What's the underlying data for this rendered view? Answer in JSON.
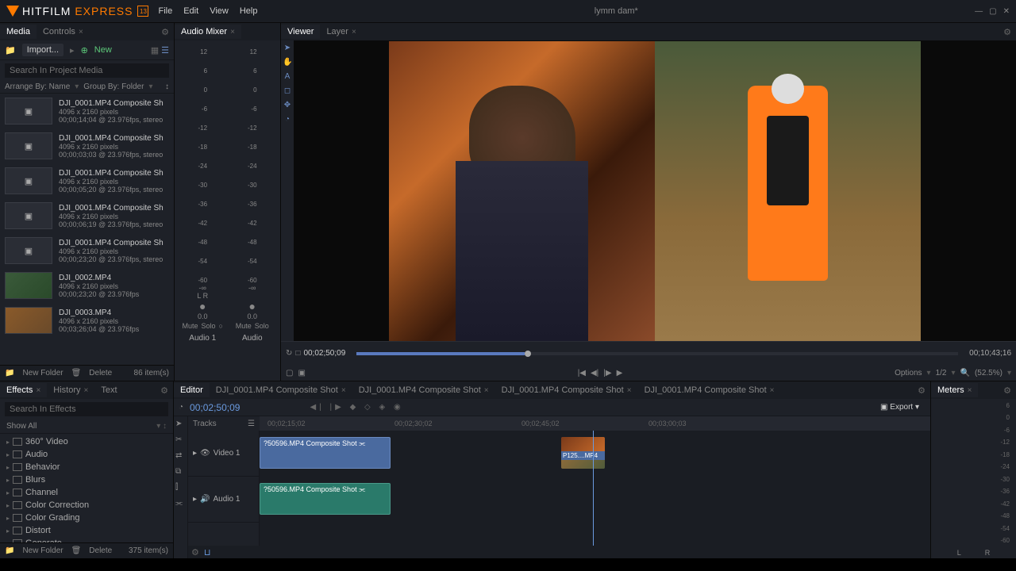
{
  "app": {
    "name_white": "HITFILM",
    "name_orange": "EXPRESS",
    "badge": "13"
  },
  "menu": [
    "File",
    "Edit",
    "View",
    "Help"
  ],
  "project": "lymm dam*",
  "panels": {
    "media": "Media",
    "controls": "Controls",
    "mixer": "Audio Mixer",
    "viewer": "Viewer",
    "layer": "Layer",
    "effects": "Effects",
    "history": "History",
    "text": "Text",
    "editor": "Editor",
    "meters": "Meters"
  },
  "media_panel": {
    "import": "Import...",
    "new": "New",
    "search_ph": "Search In Project Media",
    "arrange": "Arrange By: Name",
    "group": "Group By: Folder",
    "items": [
      {
        "name": "DJI_0001.MP4 Composite Sh",
        "dim": "4096 x 2160 pixels",
        "meta": "00;00;14;04 @ 23.976fps, stereo"
      },
      {
        "name": "DJI_0001.MP4 Composite Sh",
        "dim": "4096 x 2160 pixels",
        "meta": "00;00;03;03 @ 23.976fps, stereo"
      },
      {
        "name": "DJI_0001.MP4 Composite Sh",
        "dim": "4096 x 2160 pixels",
        "meta": "00;00;05;20 @ 23.976fps, stereo"
      },
      {
        "name": "DJI_0001.MP4 Composite Sh",
        "dim": "4096 x 2160 pixels",
        "meta": "00;00;06;19 @ 23.976fps, stereo"
      },
      {
        "name": "DJI_0001.MP4 Composite Sh",
        "dim": "4096 x 2160 pixels",
        "meta": "00;00;23;20 @ 23.976fps, stereo"
      },
      {
        "name": "DJI_0002.MP4",
        "dim": "4096 x 2160 pixels",
        "meta": "00;00;23;20 @ 23.976fps"
      },
      {
        "name": "DJI_0003.MP4",
        "dim": "4096 x 2160 pixels",
        "meta": "00;03;26;04 @ 23.976fps"
      }
    ],
    "new_folder": "New Folder",
    "delete": "Delete",
    "count": "86 item(s)"
  },
  "mixer": {
    "scale": [
      "12",
      "6",
      "0",
      "-6",
      "-12",
      "-18",
      "-24",
      "-30",
      "-36",
      "-42",
      "-48",
      "-54",
      "-60"
    ],
    "inf": "-∞",
    "val": "0.0",
    "mute": "Mute",
    "solo": "Solo",
    "ch1": "Audio 1",
    "ch2": "Audio",
    "lr": "L    R"
  },
  "viewer": {
    "time": "00;02;50;09",
    "duration": "00;10;43;16",
    "options": "Options",
    "page": "1/2",
    "zoom": "(52.5%)"
  },
  "effects": {
    "search_ph": "Search In Effects",
    "show_all": "Show All",
    "items": [
      "360° Video",
      "Audio",
      "Behavior",
      "Blurs",
      "Channel",
      "Color Correction",
      "Color Grading",
      "Distort",
      "Generate"
    ],
    "new_folder": "New Folder",
    "delete": "Delete",
    "count": "375 item(s)"
  },
  "timeline": {
    "tabs": [
      "DJI_0001.MP4 Composite Shot",
      "DJI_0001.MP4 Composite Shot",
      "DJI_0001.MP4 Composite Shot",
      "DJI_0001.MP4 Composite Shot"
    ],
    "time": "00;02;50;09",
    "tracks_label": "Tracks",
    "export": "Export",
    "ruler": [
      "00;02;15;02",
      "00;02;30;02",
      "00;02;45;02",
      "00;03;00;03"
    ],
    "track_v": "Video 1",
    "track_a": "Audio 1",
    "clip1": "?50596.MP4 Composite Shot",
    "clip2": "P125....MP4",
    "clip3": "?50596.MP4 Composite Shot"
  },
  "meters": {
    "scale": [
      "6",
      "0",
      "-6",
      "-12",
      "-18",
      "-24",
      "-30",
      "-36",
      "-42",
      "-48",
      "-54",
      "-60"
    ],
    "L": "L",
    "R": "R"
  }
}
